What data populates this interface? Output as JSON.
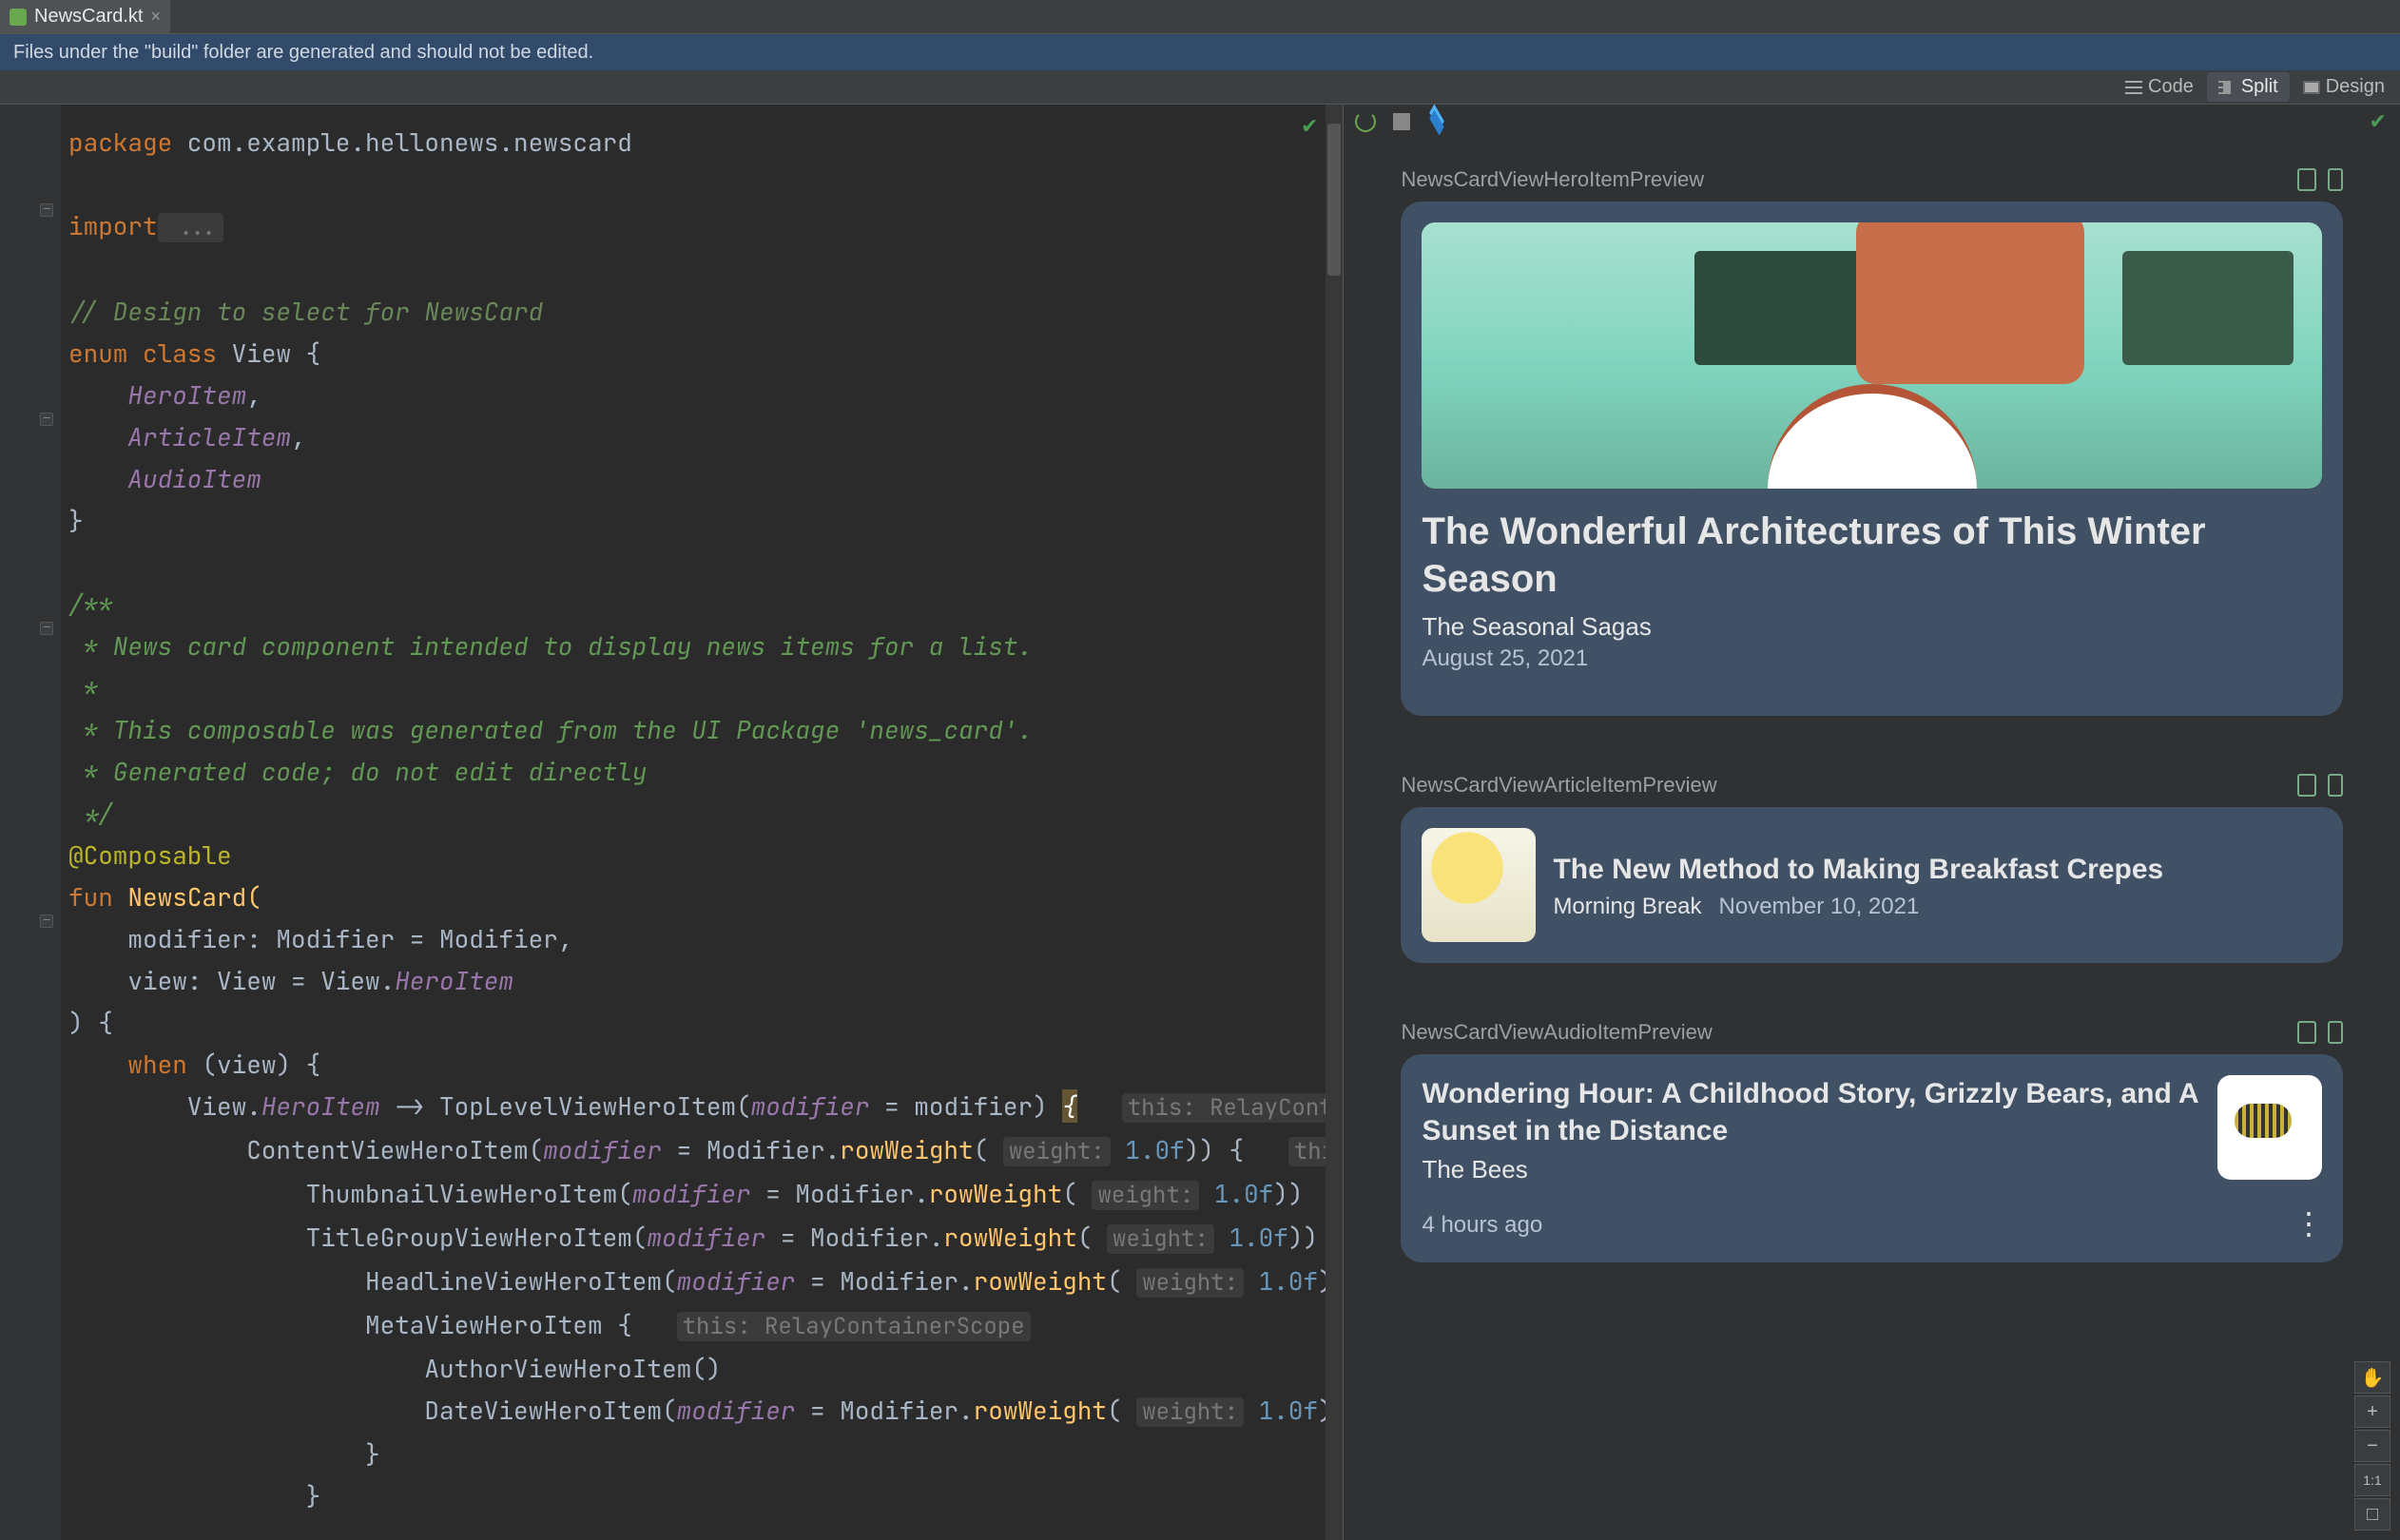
{
  "tab": {
    "file": "NewsCard.kt"
  },
  "banner": {
    "text": "Files under the \"build\" folder are generated and should not be edited."
  },
  "view_modes": {
    "code": "Code",
    "split": "Split",
    "design": "Design"
  },
  "code": {
    "package_kw": "package",
    "package_name": " com.example.hellonews.newscard",
    "import_kw": "import",
    "import_rest": " ...",
    "comment_design": "// Design to select for NewsCard",
    "enum_kw": "enum class",
    "enum_name": " View {",
    "enum_i1": "HeroItem",
    "enum_i2": "ArticleItem",
    "enum_i3": "AudioItem",
    "brace_close": "}",
    "doc1": "/**",
    "doc2": " * News card component intended to display news items for a list.",
    "doc3": " *",
    "doc4": " * This composable was generated from the UI Package 'news_card'.",
    "doc5": " * Generated code; do not edit directly",
    "doc6": " */",
    "ann": "@Composable",
    "fun_kw": "fun",
    "fun_name": " NewsCard(",
    "p1a": "    modifier: Modifier = Modifier",
    "p1c": ",",
    "p2a": "    view: View = View.",
    "p2b": "HeroItem",
    "fn_close": ") {",
    "when": "    when",
    "when_rest": " (view) {",
    "l1a": "        View.",
    "l1b": "HeroItem",
    "l1c": " -> TopLevelViewHeroItem(",
    "l1d": "modifier",
    "l1e": " = modifier) ",
    "l1brace": "{",
    "l1hint": "this: RelayContain",
    "l2a": "            ContentViewHeroItem(",
    "l2b": "modifier",
    "l2c": " = Modifier.",
    "l2d": "rowWeight",
    "l2e": "(",
    "l2hint": "weight:",
    "l2f": " 1.0f",
    "l2g": ")) {   ",
    "l2hint2": "this: R",
    "l3a": "                ThumbnailViewHeroItem(",
    "l3b": "modifier",
    "l3c": " = Modifier.",
    "l3d": "rowWeight",
    "l3e": "(",
    "l3f": " 1.0f",
    "l3g": "))",
    "l4a": "                TitleGroupViewHeroItem(",
    "l4b": "modifier",
    "l4c": " = Modifier.",
    "l4d": "rowWeight",
    "l4f": " 1.0f",
    "l4g": ")) ·",
    "l5a": "                    HeadlineViewHeroItem(",
    "l5b": "modifier",
    "l5c": " = Modifier.",
    "l5d": "rowWeight",
    "l5f": " 1.0f",
    "l5g": "))",
    "l6a": "                    MetaViewHeroItem {   ",
    "l6hint": "this: RelayContainerScope",
    "l7": "                        AuthorViewHeroItem()",
    "l8a": "                        DateViewHeroItem(",
    "l8b": "modifier",
    "l8c": " = Modifier.",
    "l8d": "rowWeight",
    "l8f": " 1.0f",
    "l8g": "))",
    "l9": "                    }",
    "l10": "                }"
  },
  "previews": {
    "hero": {
      "name": "NewsCardViewHeroItemPreview",
      "headline": "The Wonderful Architectures of This Winter Season",
      "author": "The Seasonal Sagas",
      "date": "August 25, 2021"
    },
    "article": {
      "name": "NewsCardViewArticleItemPreview",
      "headline": "The New Method to Making Breakfast Crepes",
      "author": "Morning Break",
      "date": "November 10, 2021"
    },
    "audio": {
      "name": "NewsCardViewAudioItemPreview",
      "headline": "Wondering Hour: A Childhood Story, Grizzly Bears, and A Sunset in the Distance",
      "author": "The Bees",
      "time": "4 hours ago"
    }
  },
  "zoom": {
    "ratio": "1:1",
    "plus": "+",
    "minus": "−",
    "hand": "✋"
  }
}
